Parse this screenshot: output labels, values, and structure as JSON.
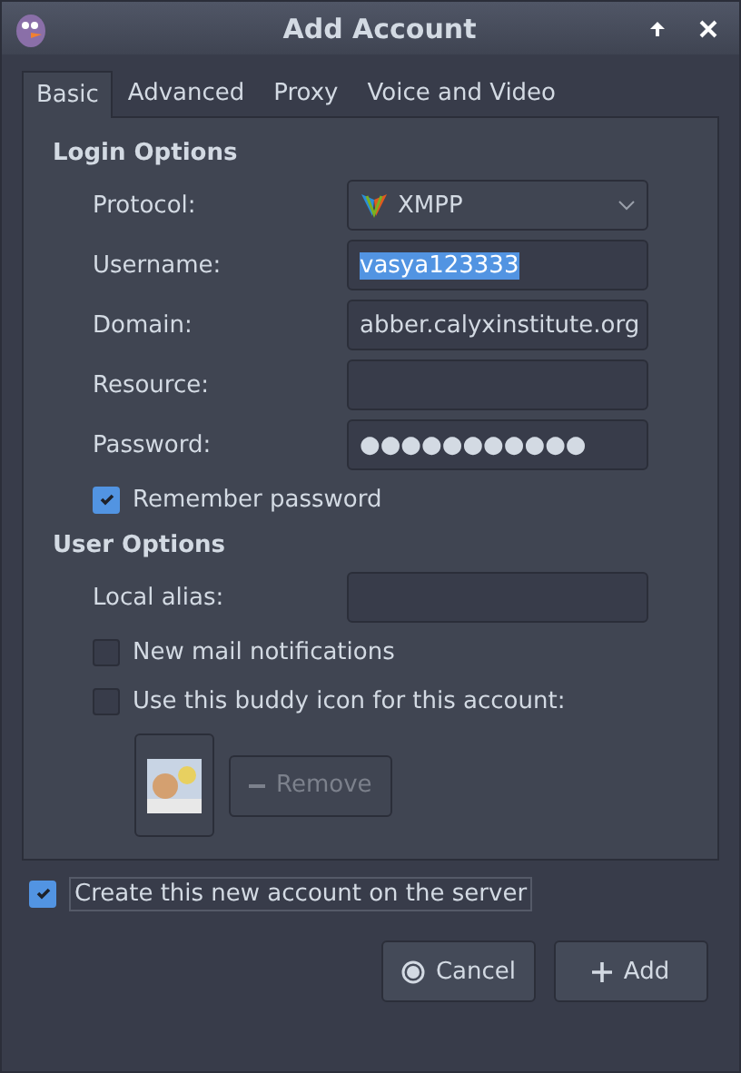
{
  "window": {
    "title": "Add Account"
  },
  "tabs": [
    {
      "label": "Basic",
      "selected": true
    },
    {
      "label": "Advanced",
      "selected": false
    },
    {
      "label": "Proxy",
      "selected": false
    },
    {
      "label": "Voice and Video",
      "selected": false
    }
  ],
  "login_options": {
    "heading": "Login Options",
    "fields": [
      {
        "label": "Protocol:",
        "kind": "select",
        "value": "XMPP"
      },
      {
        "label": "Username:",
        "kind": "text",
        "value": "vasya123333",
        "selected": true
      },
      {
        "label": "Domain:",
        "kind": "text",
        "value": "abber.calyxinstitute.org"
      },
      {
        "label": "Resource:",
        "kind": "text"
      },
      {
        "label": "Password:",
        "kind": "text",
        "value": "●●●●●●●●●●●"
      }
    ],
    "remember": {
      "label": "Remember password",
      "checked": true
    }
  },
  "user_options": {
    "heading": "User Options",
    "alias_label": "Local alias:",
    "checks": [
      {
        "label": "New mail notifications",
        "checked": false
      },
      {
        "label": "Use this buddy icon for this account:",
        "checked": false
      }
    ],
    "remove_button": {
      "label": "Remove",
      "disabled": true
    }
  },
  "create_on_server": {
    "label": "Create this new account on the server",
    "checked": true
  },
  "buttons": [
    {
      "label": "Cancel",
      "kind": "cancel"
    },
    {
      "label": "Add",
      "kind": "add"
    }
  ]
}
